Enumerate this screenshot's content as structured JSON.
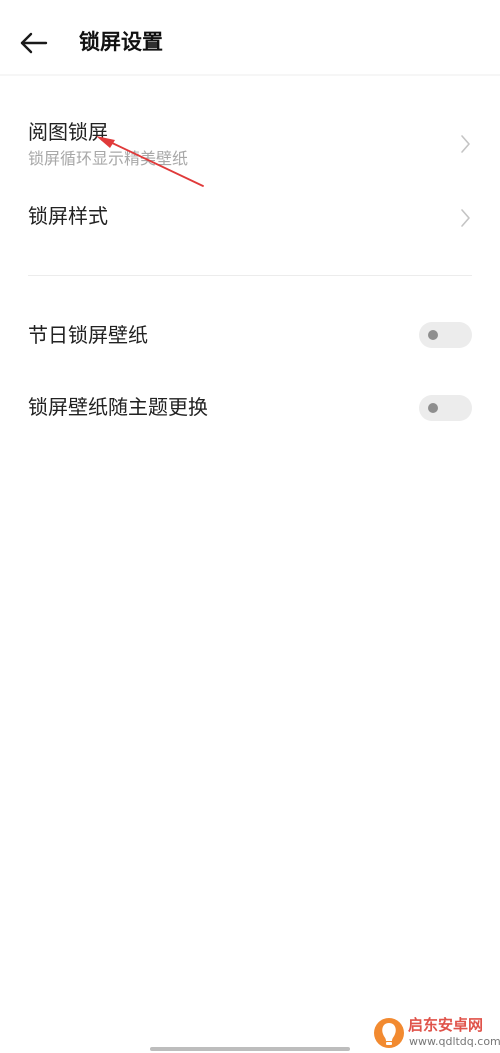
{
  "header": {
    "title": "锁屏设置",
    "back_icon": "arrow-left-icon"
  },
  "section1": {
    "items": [
      {
        "title": "阅图锁屏",
        "subtitle": "锁屏循环显示精美壁纸",
        "icon": "chevron-right-icon"
      },
      {
        "title": "锁屏样式",
        "icon": "chevron-right-icon"
      }
    ]
  },
  "section2": {
    "items": [
      {
        "title": "节日锁屏壁纸",
        "enabled": false
      },
      {
        "title": "锁屏壁纸随主题更换",
        "enabled": false
      }
    ]
  },
  "annotation": {
    "type": "arrow",
    "color": "#e03a3a"
  },
  "watermark": {
    "name": "启东安卓网",
    "url": "www.qdltdq.com",
    "color": "#e0534a"
  },
  "colors": {
    "subtitle": "#a8a8a8",
    "toggle_off_track": "#ececec",
    "toggle_off_knob": "#8e8e8e"
  }
}
